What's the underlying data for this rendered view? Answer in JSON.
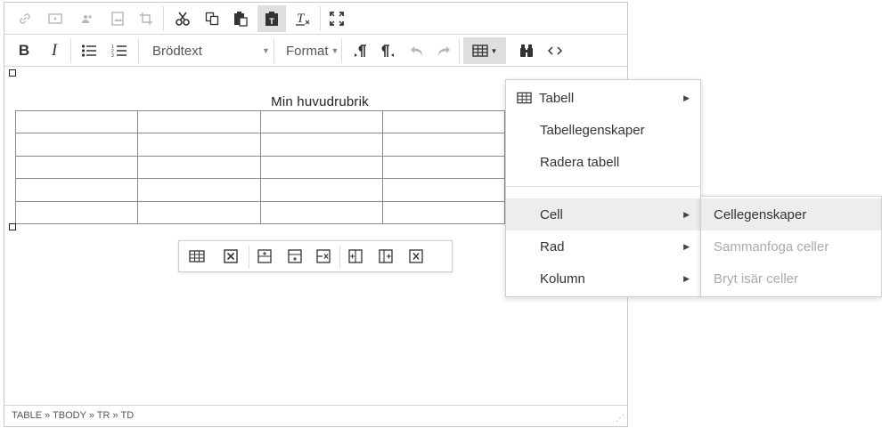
{
  "toolbar": {
    "block_format_label": "Brödtext",
    "format_label": "Format"
  },
  "document": {
    "heading": "Min huvudrubrik",
    "table_rows": 5,
    "table_cols": 4
  },
  "status_path": "TABLE » TBODY » TR » TD",
  "table_menu": {
    "items": [
      {
        "label": "Tabell",
        "submenu": true
      },
      {
        "label": "Tabellegenskaper"
      },
      {
        "label": "Radera tabell"
      },
      {
        "label": "Cell",
        "submenu": true,
        "highlighted": true
      },
      {
        "label": "Rad",
        "submenu": true
      },
      {
        "label": "Kolumn",
        "submenu": true
      }
    ]
  },
  "cell_submenu": {
    "items": [
      {
        "label": "Cellegenskaper",
        "highlighted": true,
        "disabled": false
      },
      {
        "label": "Sammanfoga celler",
        "disabled": true
      },
      {
        "label": "Bryt isär celler",
        "disabled": true
      }
    ]
  },
  "colors": {
    "highlight": "#ededed",
    "disabled_text": "#aaaaaa",
    "border": "#cfcfcf"
  }
}
